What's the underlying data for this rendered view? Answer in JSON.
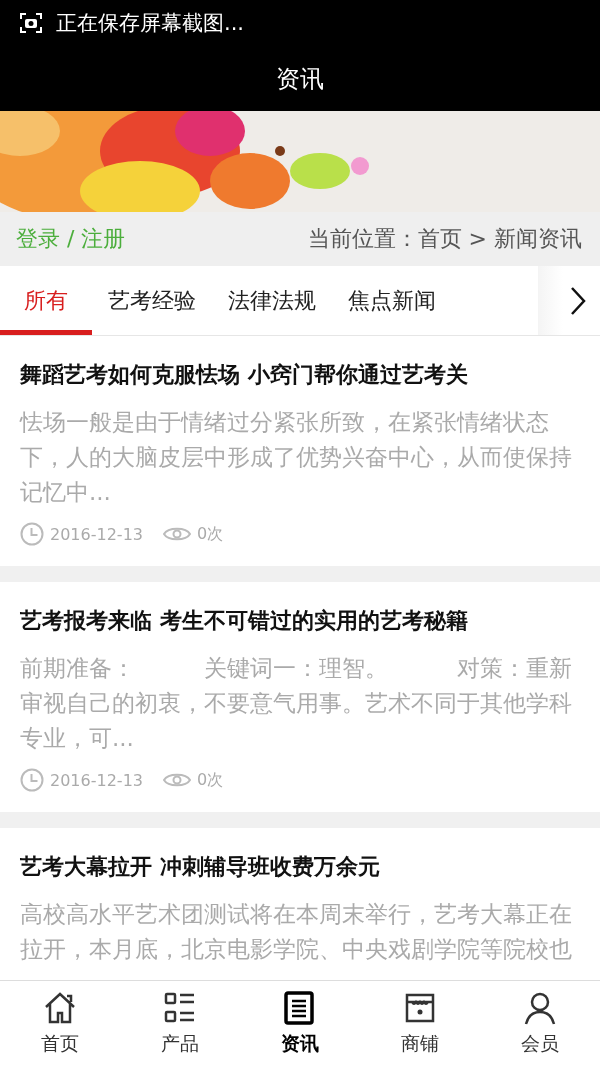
{
  "status_bar": {
    "notification": "正在保存屏幕截图..."
  },
  "header": {
    "title": "资讯"
  },
  "breadcrumb": {
    "login": "登录 / 注册",
    "location": "当前位置：首页 > 新闻资讯"
  },
  "tabs": [
    {
      "label": "所有",
      "selected": true
    },
    {
      "label": "艺考经验",
      "selected": false
    },
    {
      "label": "法律法规",
      "selected": false
    },
    {
      "label": "焦点新闻",
      "selected": false
    }
  ],
  "articles": [
    {
      "title": "舞蹈艺考如何克服怯场 小窍门帮你通过艺考关",
      "summary": "怯场一般是由于情绪过分紧张所致，在紧张情绪状态下，人的大脑皮层中形成了优势兴奋中心，从而使保持记忆中...",
      "date": "2016-12-13",
      "views": "0次"
    },
    {
      "title": "艺考报考来临 考生不可错过的实用的艺考秘籍",
      "summary": "前期准备：　　　关键词一：理智。　　　对策：重新审视自己的初衷，不要意气用事。艺术不同于其他学科专业，可...",
      "date": "2016-12-13",
      "views": "0次"
    },
    {
      "title": "艺考大幕拉开 冲刺辅导班收费万余元",
      "summary": "高校高水平艺术团测试将在本周末举行，艺考大幕正在拉开，本月底，北京电影学院、中央戏剧学院等院校也"
    }
  ],
  "bottom_nav": [
    {
      "label": "首页",
      "kind": "home",
      "selected": false
    },
    {
      "label": "产品",
      "kind": "list",
      "selected": false
    },
    {
      "label": "资讯",
      "kind": "news",
      "selected": true
    },
    {
      "label": "商铺",
      "kind": "shop",
      "selected": false
    },
    {
      "label": "会员",
      "kind": "user",
      "selected": false
    }
  ]
}
